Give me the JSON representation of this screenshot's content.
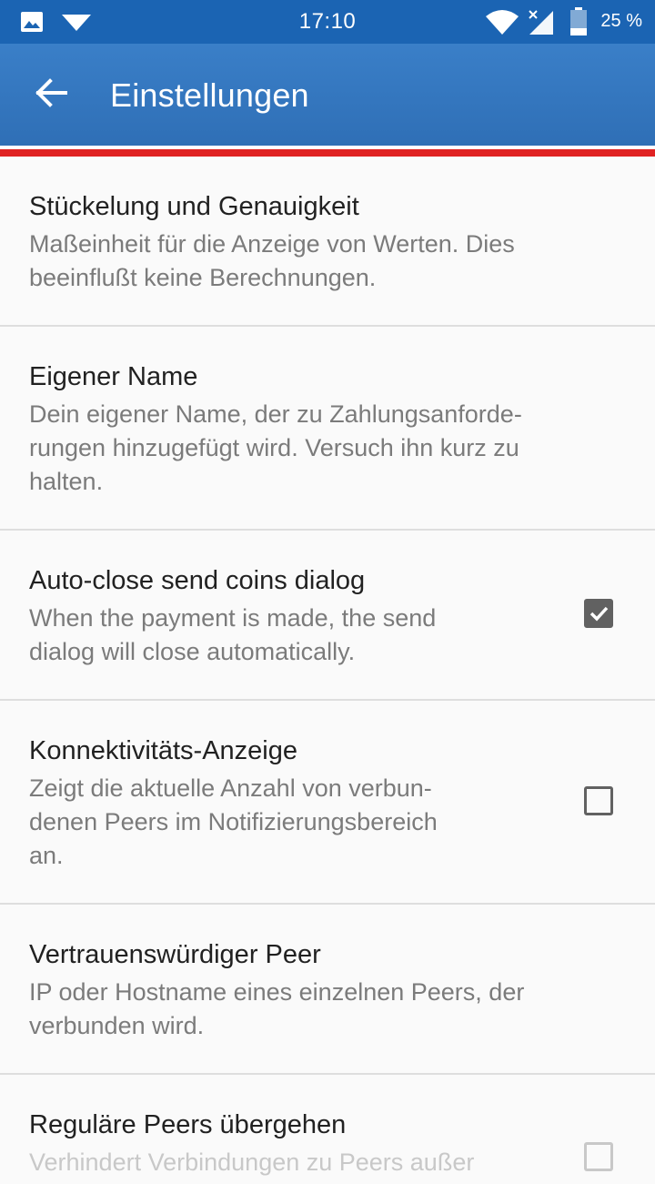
{
  "status_bar": {
    "time": "17:10",
    "battery_percent": "25 %",
    "icons": [
      "image-icon",
      "download-icon",
      "wifi-icon",
      "signal-icon",
      "battery-icon"
    ]
  },
  "app_bar": {
    "title": "Einstellungen",
    "back_icon": "arrow-left-icon"
  },
  "colors": {
    "primary": "#2f6fb6",
    "status_bar": "#1b64b3",
    "accent_stripe": "#e02222",
    "checkbox": "#616161"
  },
  "settings": [
    {
      "title": "Stückelung und Genauigkeit",
      "summary": "Maßeinheit für die Anzeige von Werten. Dies\nbeeinflußt keine Berechnungen."
    },
    {
      "title": "Eigener Name",
      "summary": "Dein eigener Name, der zu Zahlungsanforde-\nrungen hinzugefügt wird. Versuch ihn kurz zu\nhalten."
    },
    {
      "title": "Auto-close send coins dialog",
      "summary": "When the payment is made, the send\ndialog will close automatically.",
      "checked": true
    },
    {
      "title": "Konnektivitäts-Anzeige",
      "summary": "Zeigt die aktuelle Anzahl von verbun-\ndenen Peers im Notifizierungsbereich\nan.",
      "checked": false
    },
    {
      "title": "Vertrauenswürdiger Peer",
      "summary": "IP oder Hostname eines einzelnen Peers, der\nverbunden wird."
    },
    {
      "title": "Reguläre Peers übergehen",
      "summary": "Verhindert Verbindungen zu Peers außer",
      "checked": false
    }
  ]
}
